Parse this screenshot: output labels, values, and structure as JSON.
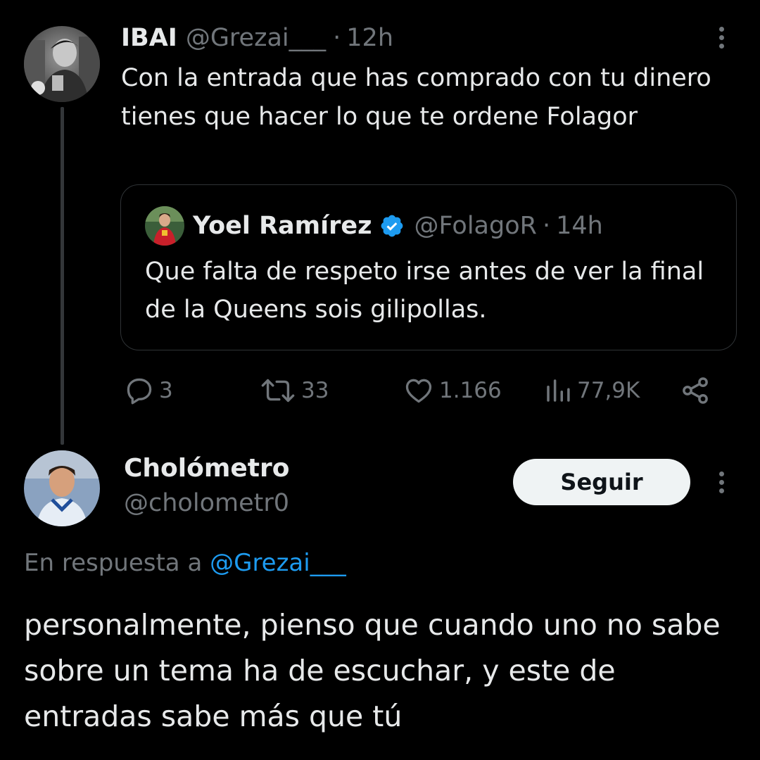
{
  "main_tweet": {
    "author_name": "IBAI",
    "author_handle": "@Grezai___",
    "separator": "·",
    "timestamp": "12h",
    "text": "Con la entrada que has comprado con tu dinero tienes que hacer lo que te ordene Folagor",
    "more_icon": "more-vertical-icon"
  },
  "quoted_tweet": {
    "author_name": "Yoel Ramírez",
    "verified_icon": "verified-badge-icon",
    "author_handle": "@FolagoR",
    "separator": "·",
    "timestamp": "14h",
    "text": "Que falta de respeto irse antes de ver la final de la Queens sois gilipollas."
  },
  "actions": {
    "replies": "3",
    "retweets": "33",
    "likes": "1.166",
    "views": "77,9K"
  },
  "reply_tweet": {
    "author_name": "Cholómetro",
    "author_handle": "@cholometr0",
    "follow_label": "Seguir",
    "reply_prefix": "En respuesta a",
    "reply_mention": "@Grezai___",
    "text": "personalmente, pienso que cuando uno no sabe sobre un tema ha de escuchar, y este de entradas sabe más que tú"
  },
  "colors": {
    "background": "#000000",
    "text_primary": "#e7e9ea",
    "text_secondary": "#71767b",
    "link": "#1d9bf0",
    "verified": "#1d9bf0",
    "follow_button_bg": "#eff3f4"
  }
}
